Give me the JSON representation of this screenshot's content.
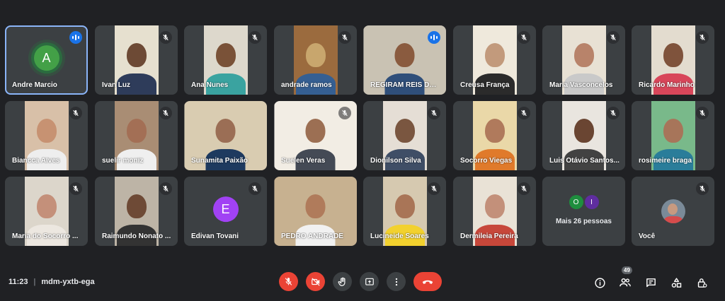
{
  "meeting": {
    "time": "11:23",
    "separator": "|",
    "code": "mdm-yxtb-ega"
  },
  "participants": [
    {
      "name": "Andre Marcio",
      "type": "avatar",
      "initial": "A",
      "avatar_color": "#43a047",
      "active": true,
      "status": "speaking"
    },
    {
      "name": "Ivan Luz",
      "type": "video",
      "bg": "#e6e0cf",
      "skin": "#6d4a35",
      "shirt": "#2e3c5a",
      "status": "muted"
    },
    {
      "name": "Ana Nunes",
      "type": "video",
      "bg": "#ddd8cc",
      "skin": "#7a5238",
      "shirt": "#3aa3a0",
      "status": "muted"
    },
    {
      "name": "andrade ramos",
      "type": "video",
      "bg": "#9b6b3e",
      "skin": "#c8a66d",
      "shirt": "#355f92",
      "status": "muted"
    },
    {
      "name": "REGIRAM REIS DE ...",
      "type": "video",
      "wide": true,
      "bg": "#c9c2b3",
      "skin": "#8a5b3f",
      "shirt": "#2f4f7a",
      "status": "speaking"
    },
    {
      "name": "Creusa França",
      "type": "video",
      "bg": "#efe9dc",
      "skin": "#c29a7c",
      "shirt": "#2b2b2b",
      "status": "muted"
    },
    {
      "name": "Maria Vasconcelos",
      "type": "video",
      "bg": "#e8e1d4",
      "skin": "#b8836a",
      "shirt": "#c9c9c9",
      "status": "muted"
    },
    {
      "name": "Ricardo Marinho",
      "type": "video",
      "bg": "#e3dccf",
      "skin": "#7f533c",
      "shirt": "#d8465a",
      "status": "muted"
    },
    {
      "name": "Biancca Alves",
      "type": "video",
      "bg": "#d8c0a8",
      "skin": "#c79272",
      "shirt": "#eeeeee",
      "status": "muted"
    },
    {
      "name": "suelir moniz",
      "type": "video",
      "bg": "#a98d74",
      "skin": "#a36f55",
      "shirt": "#efefef",
      "status": "muted"
    },
    {
      "name": "Sunamita Paixão",
      "type": "video",
      "wide": true,
      "bg": "#d9ccb1",
      "skin": "#9b6e55",
      "shirt": "#1e3a5f",
      "status": "none"
    },
    {
      "name": "Suelen Veras",
      "type": "video",
      "wide": true,
      "bg": "#f2ede4",
      "skin": "#9c6f53",
      "shirt": "#444a55",
      "status": "muted"
    },
    {
      "name": "Dionilson Silva",
      "type": "video",
      "bg": "#e5ded5",
      "skin": "#7a5640",
      "shirt": "#3f4e66",
      "status": "muted"
    },
    {
      "name": "Socorro Viegas",
      "type": "video",
      "bg": "#ead8a8",
      "skin": "#b07a5c",
      "shirt": "#e07a2b",
      "status": "muted"
    },
    {
      "name": "Luis Otávio Santos...",
      "type": "video",
      "bg": "#e9e5df",
      "skin": "#6a4532",
      "shirt": "#424242",
      "status": "muted"
    },
    {
      "name": "rosimeire braga",
      "type": "video",
      "bg": "#79b98a",
      "skin": "#a7755a",
      "shirt": "#2a7d9a",
      "status": "muted"
    },
    {
      "name": "Maria do Socorro ...",
      "type": "video",
      "bg": "#dcd6cb",
      "skin": "#c4907a",
      "shirt": "#ece7e0",
      "status": "muted"
    },
    {
      "name": "Raimundo Nonato ...",
      "type": "video",
      "bg": "#bdb4a6",
      "skin": "#6e4a36",
      "shirt": "#333333",
      "status": "muted"
    },
    {
      "name": "Edivan Tovani",
      "type": "avatar",
      "initial": "E",
      "avatar_color": "#a142f4",
      "status": "muted"
    },
    {
      "name": "PEDRO ANDRADE",
      "type": "video",
      "wide": true,
      "bg": "#c7b190",
      "skin": "#b07b5b",
      "shirt": "#f1f1f1",
      "status": "none"
    },
    {
      "name": "Lucineide Soares",
      "type": "video",
      "bg": "#d6c9b0",
      "skin": "#a97557",
      "shirt": "#f2d12e",
      "status": "muted"
    },
    {
      "name": "Dermileia Pereira",
      "type": "video",
      "bg": "#e9e2d6",
      "skin": "#c3907a",
      "shirt": "#c7473a",
      "status": "muted"
    },
    {
      "name": "",
      "type": "more",
      "more_label": "Mais 26 pessoas",
      "minis": [
        {
          "initial": "O",
          "color": "#1e8e3e"
        },
        {
          "initial": "I",
          "color": "#5f2da0"
        }
      ]
    },
    {
      "name": "Você",
      "type": "self",
      "status": "muted"
    }
  ],
  "controls": [
    {
      "name": "mic-off-button",
      "icon": "mic-off-icon",
      "style": "red"
    },
    {
      "name": "camera-off-button",
      "icon": "camera-off-icon",
      "style": "red"
    },
    {
      "name": "raise-hand-button",
      "icon": "hand-icon",
      "style": "normal"
    },
    {
      "name": "present-button",
      "icon": "present-icon",
      "style": "normal"
    },
    {
      "name": "more-options-button",
      "icon": "more-vert-icon",
      "style": "normal"
    },
    {
      "name": "leave-call-button",
      "icon": "hang-up-icon",
      "style": "hang"
    }
  ],
  "right_icons": [
    {
      "name": "meeting-details-button",
      "icon": "info-icon"
    },
    {
      "name": "people-button",
      "icon": "people-icon",
      "badge": "49"
    },
    {
      "name": "chat-button",
      "icon": "chat-icon"
    },
    {
      "name": "activities-button",
      "icon": "activities-icon"
    },
    {
      "name": "host-controls-button",
      "icon": "lock-icon"
    }
  ]
}
